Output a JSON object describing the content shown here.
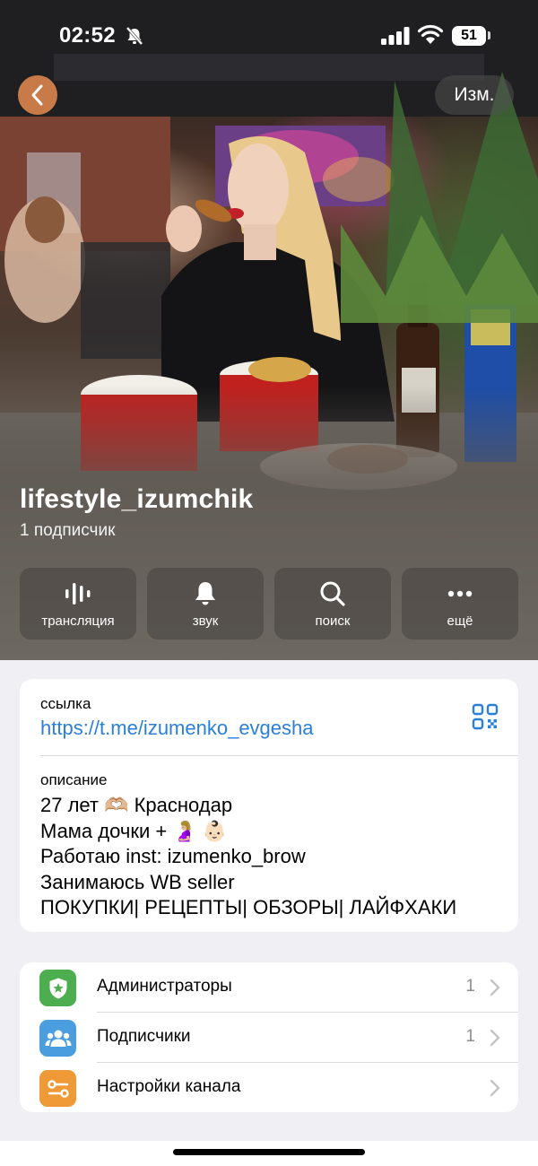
{
  "status_bar": {
    "time": "02:52",
    "battery": "51"
  },
  "nav": {
    "edit_label": "Изм."
  },
  "channel": {
    "name": "lifestyle_izumchik",
    "subscribers": "1 подписчик"
  },
  "actions": [
    {
      "label": "трансляция",
      "icon": "broadcast-icon"
    },
    {
      "label": "звук",
      "icon": "bell-icon"
    },
    {
      "label": "поиск",
      "icon": "search-icon"
    },
    {
      "label": "ещё",
      "icon": "more-icon"
    }
  ],
  "info": {
    "link_label": "ссылка",
    "link_value": "https://t.me/izumenko_evgesha",
    "description_label": "описание",
    "description_lines": [
      "27 лет 🫶🏼 Краснодар",
      "Мама дочки + 🤰🏼 👶🏻",
      "Работаю inst: izumenko_brow",
      "Занимаюсь WB seller",
      "ПОКУПКИ| РЕЦЕПТЫ| ОБЗОРЫ| ЛАЙФХАКИ"
    ]
  },
  "settings": [
    {
      "label": "Администраторы",
      "count": "1",
      "icon": "admin-shield-icon",
      "color": "#4cae4f"
    },
    {
      "label": "Подписчики",
      "count": "1",
      "icon": "subscribers-icon",
      "color": "#4a9ee0"
    },
    {
      "label": "Настройки канала",
      "count": "",
      "icon": "channel-settings-icon",
      "color": "#f09a37"
    }
  ]
}
